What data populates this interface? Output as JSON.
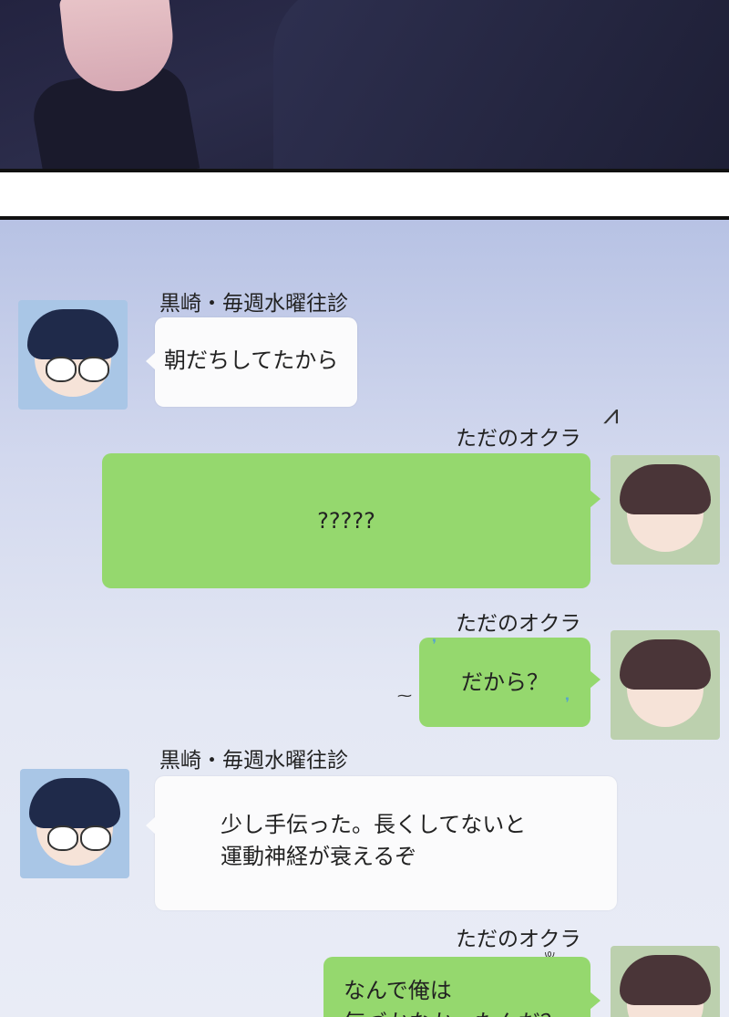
{
  "messages": [
    {
      "sender": "黒崎・毎週水曜往診",
      "text": "朝だちしてたから"
    },
    {
      "sender": "ただのオクラ",
      "text": "?????"
    },
    {
      "sender": "ただのオクラ",
      "text": "だから？"
    },
    {
      "sender": "黒崎・毎週水曜往診",
      "lines": [
        "少し手伝った。長くしてないと",
        "運動神経が衰えるぞ"
      ]
    },
    {
      "sender": "ただのオクラ",
      "lines": [
        "なんで俺は",
        "気づかなかったんだ？"
      ]
    }
  ],
  "colors": {
    "sent_bubble": "#95d86e",
    "received_bubble": "#fbfbfc"
  },
  "icons": [
    "kurosaki-avatar",
    "okura-avatar",
    "anger-mark-icon",
    "sweat-drop-icon"
  ]
}
